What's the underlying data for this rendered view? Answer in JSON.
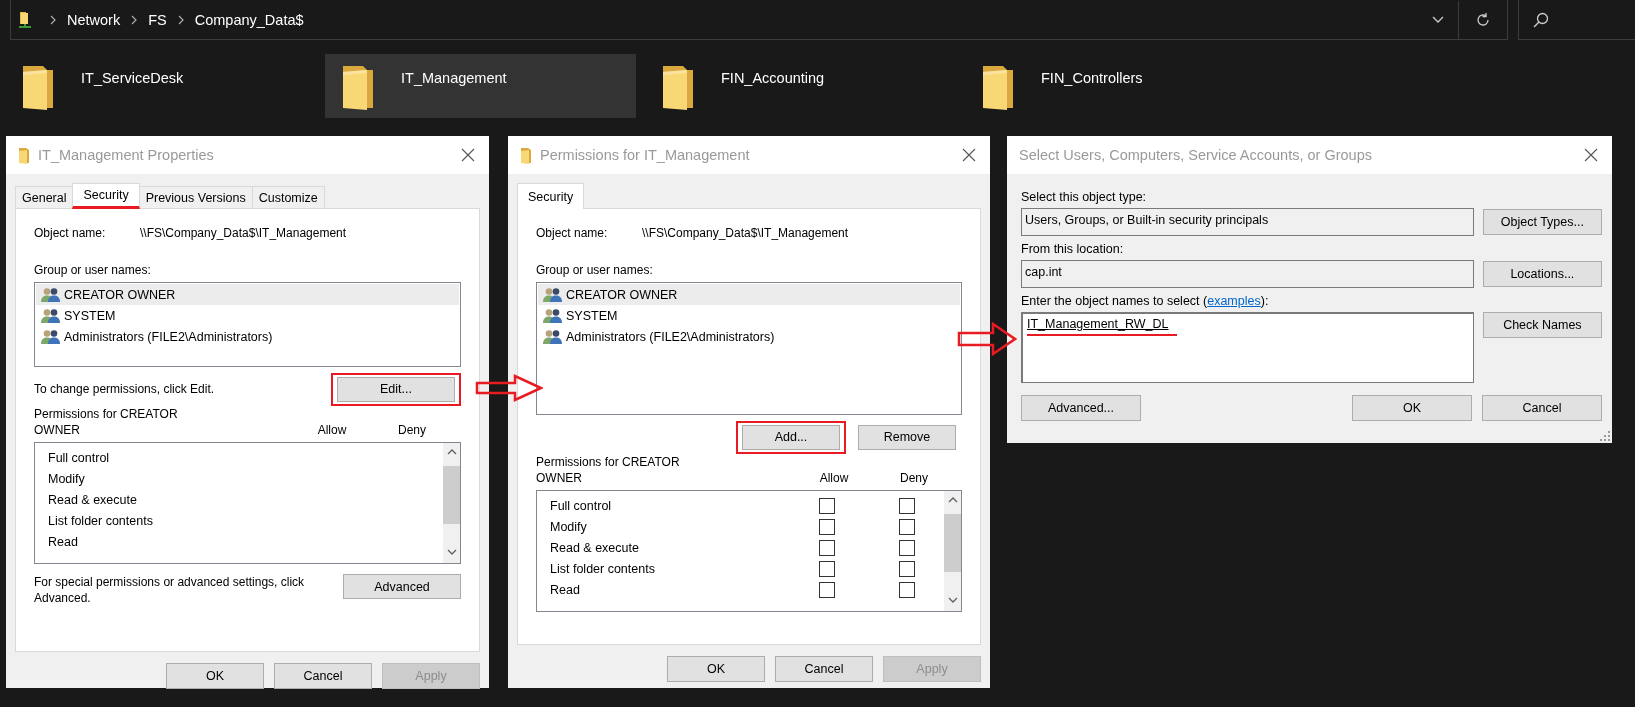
{
  "address_bar": {
    "crumbs": [
      "Network",
      "FS",
      "Company_Data$"
    ]
  },
  "folders": [
    {
      "name": "IT_ServiceDesk",
      "selected": false
    },
    {
      "name": "IT_Management",
      "selected": true
    },
    {
      "name": "FIN_Accounting",
      "selected": false
    },
    {
      "name": "FIN_Controllers",
      "selected": false
    }
  ],
  "dialogs": [
    {
      "kind": "properties",
      "title": "IT_Management Properties",
      "tabs": [
        {
          "label": "General",
          "selected": false,
          "highlighted": false
        },
        {
          "label": "Security",
          "selected": true,
          "highlighted": true
        },
        {
          "label": "Previous Versions",
          "selected": false,
          "highlighted": false
        },
        {
          "label": "Customize",
          "selected": false,
          "highlighted": false
        }
      ],
      "object_label": "Object name:",
      "object_name": "\\\\FS\\Company_Data$\\IT_Management",
      "groups_label": "Group or user names:",
      "principals": [
        {
          "name": "CREATOR OWNER",
          "selected": true
        },
        {
          "name": "SYSTEM",
          "selected": false
        },
        {
          "name": "Administrators (FILE2\\Administrators)",
          "selected": false
        }
      ],
      "hint": "To change permissions, click Edit.",
      "actions": [
        {
          "label": "Edit...",
          "highlighted": true
        }
      ],
      "permissions_label": "Permissions for CREATOR OWNER",
      "allow_label": "Allow",
      "deny_label": "Deny",
      "permissions": [
        {
          "name": "Full control"
        },
        {
          "name": "Modify"
        },
        {
          "name": "Read & execute"
        },
        {
          "name": "List folder contents"
        },
        {
          "name": "Read"
        }
      ],
      "advanced_hint": "For special permissions or advanced settings, click Advanced.",
      "advanced_button": "Advanced",
      "buttons": [
        {
          "label": "OK",
          "disabled": false
        },
        {
          "label": "Cancel",
          "disabled": false
        },
        {
          "label": "Apply",
          "disabled": true
        }
      ]
    },
    {
      "kind": "permissions",
      "title": "Permissions for IT_Management",
      "tabs": [
        {
          "label": "Security",
          "selected": true,
          "highlighted": false
        }
      ],
      "object_label": "Object name:",
      "object_name": "\\\\FS\\Company_Data$\\IT_Management",
      "groups_label": "Group or user names:",
      "principals": [
        {
          "name": "CREATOR OWNER",
          "selected": true
        },
        {
          "name": "SYSTEM",
          "selected": false
        },
        {
          "name": "Administrators (FILE2\\Administrators)",
          "selected": false
        }
      ],
      "actions": [
        {
          "label": "Add...",
          "highlighted": true
        },
        {
          "label": "Remove",
          "highlighted": false
        }
      ],
      "permissions_label": "Permissions for CREATOR OWNER",
      "allow_label": "Allow",
      "deny_label": "Deny",
      "permissions": [
        {
          "name": "Full control",
          "allow": false,
          "deny": false
        },
        {
          "name": "Modify",
          "allow": false,
          "deny": false
        },
        {
          "name": "Read & execute",
          "allow": false,
          "deny": false
        },
        {
          "name": "List folder contents",
          "allow": false,
          "deny": false
        },
        {
          "name": "Read",
          "allow": false,
          "deny": false
        }
      ],
      "buttons": [
        {
          "label": "OK",
          "disabled": false
        },
        {
          "label": "Cancel",
          "disabled": false
        },
        {
          "label": "Apply",
          "disabled": true
        }
      ]
    }
  ],
  "select_dialog": {
    "title": "Select Users, Computers, Service Accounts, or Groups",
    "object_type_label": "Select this object type:",
    "object_type": "Users, Groups, or Built-in security principals",
    "object_types_button": "Object Types...",
    "location_label": "From this location:",
    "location": "cap.int",
    "locations_button": "Locations...",
    "names_label": "Enter the object names to select (",
    "names_link": "examples",
    "names_label_end": "):",
    "names_value": "IT_Management_RW_DL",
    "names_highlighted": true,
    "check_names_button": "Check Names",
    "advanced_button": "Advanced...",
    "buttons": [
      {
        "label": "OK",
        "disabled": false
      },
      {
        "label": "Cancel",
        "disabled": false
      }
    ]
  }
}
